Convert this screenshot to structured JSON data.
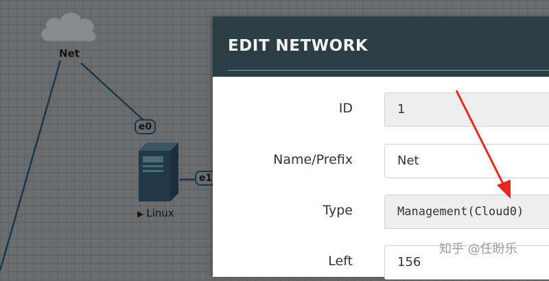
{
  "topology": {
    "cloud_node": {
      "label": "Net"
    },
    "server_node": {
      "label": "Linux"
    },
    "interfaces": [
      "e0",
      "e1"
    ]
  },
  "dialog": {
    "title": "EDIT NETWORK",
    "fields": [
      {
        "label": "ID",
        "value": "1"
      },
      {
        "label": "Name/Prefix",
        "value": "Net"
      },
      {
        "label": "Type",
        "value": "Management(Cloud0)"
      },
      {
        "label": "Left",
        "value": "156"
      }
    ]
  },
  "annotation": {
    "arrow_color": "#e8261e"
  },
  "watermark": "知乎 @任盼乐",
  "colors": {
    "canvas_bg": "#6b6c6e",
    "link": "#14394f",
    "header_bg": "#2c3e43",
    "field_readonly_bg": "#eeeeee"
  }
}
